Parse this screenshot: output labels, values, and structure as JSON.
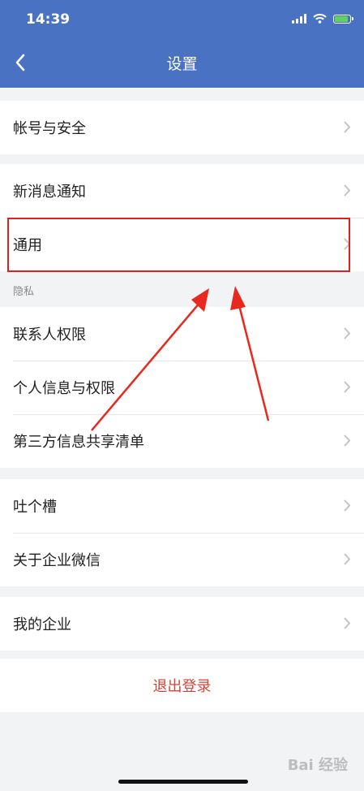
{
  "status_bar": {
    "time": "14:39"
  },
  "header": {
    "title": "设置"
  },
  "groups": {
    "account": [
      "帐号与安全"
    ],
    "notifications": [
      "新消息通知",
      "通用"
    ],
    "privacy_label": "隐私",
    "privacy": [
      "联系人权限",
      "个人信息与权限",
      "第三方信息共享清单"
    ],
    "feedback": [
      "吐个槽",
      "关于企业微信"
    ],
    "enterprise": [
      "我的企业"
    ]
  },
  "logout_label": "退出登录",
  "watermark": "Bai 经验",
  "colors": {
    "header_bg": "#4a72c2",
    "logout_text": "#d0463b",
    "annotation_red": "#e0201e"
  }
}
